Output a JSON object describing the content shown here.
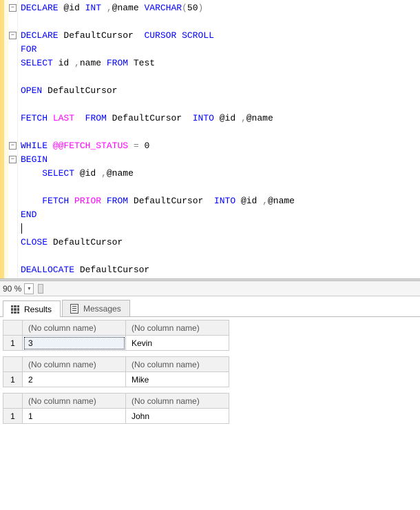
{
  "editor": {
    "lines": [
      {
        "fold": "-",
        "tokens": [
          {
            "t": "DECLARE",
            "c": "kw"
          },
          {
            "t": " @id ",
            "c": "id"
          },
          {
            "t": "INT",
            "c": "ty"
          },
          {
            "t": " ",
            "c": "id"
          },
          {
            "t": ",",
            "c": "op"
          },
          {
            "t": "@name ",
            "c": "id"
          },
          {
            "t": "VARCHAR",
            "c": "ty"
          },
          {
            "t": "(",
            "c": "op"
          },
          {
            "t": "50",
            "c": "num"
          },
          {
            "t": ")",
            "c": "op"
          }
        ]
      },
      {
        "tokens": []
      },
      {
        "fold": "-",
        "tokens": [
          {
            "t": "DECLARE",
            "c": "kw"
          },
          {
            "t": " DefaultCursor  ",
            "c": "id"
          },
          {
            "t": "CURSOR",
            "c": "kw"
          },
          {
            "t": " ",
            "c": "id"
          },
          {
            "t": "SCROLL",
            "c": "kw"
          }
        ]
      },
      {
        "tokens": [
          {
            "t": "FOR",
            "c": "kw"
          }
        ]
      },
      {
        "tokens": [
          {
            "t": "SELECT",
            "c": "kw"
          },
          {
            "t": " id ",
            "c": "id"
          },
          {
            "t": ",",
            "c": "op"
          },
          {
            "t": "name ",
            "c": "id"
          },
          {
            "t": "FROM",
            "c": "kw"
          },
          {
            "t": " Test",
            "c": "id"
          }
        ]
      },
      {
        "tokens": []
      },
      {
        "tokens": [
          {
            "t": "OPEN",
            "c": "kw"
          },
          {
            "t": " DefaultCursor",
            "c": "id"
          }
        ]
      },
      {
        "tokens": []
      },
      {
        "tokens": [
          {
            "t": "FETCH",
            "c": "kw"
          },
          {
            "t": " ",
            "c": "id"
          },
          {
            "t": "LAST",
            "c": "fn"
          },
          {
            "t": "  ",
            "c": "id"
          },
          {
            "t": "FROM",
            "c": "kw"
          },
          {
            "t": " DefaultCursor  ",
            "c": "id"
          },
          {
            "t": "INTO",
            "c": "kw"
          },
          {
            "t": " @id ",
            "c": "id"
          },
          {
            "t": ",",
            "c": "op"
          },
          {
            "t": "@name",
            "c": "id"
          }
        ]
      },
      {
        "tokens": []
      },
      {
        "fold": "-",
        "tokens": [
          {
            "t": "WHILE",
            "c": "kw"
          },
          {
            "t": " ",
            "c": "id"
          },
          {
            "t": "@@FETCH_STATUS",
            "c": "fn"
          },
          {
            "t": " ",
            "c": "id"
          },
          {
            "t": "=",
            "c": "op"
          },
          {
            "t": " 0",
            "c": "num"
          }
        ]
      },
      {
        "fold": "-",
        "tokens": [
          {
            "t": "BEGIN",
            "c": "kw"
          }
        ]
      },
      {
        "tokens": [
          {
            "t": "    ",
            "c": "id"
          },
          {
            "t": "SELECT",
            "c": "kw"
          },
          {
            "t": " @id ",
            "c": "id"
          },
          {
            "t": ",",
            "c": "op"
          },
          {
            "t": "@name",
            "c": "id"
          }
        ]
      },
      {
        "tokens": []
      },
      {
        "tokens": [
          {
            "t": "    ",
            "c": "id"
          },
          {
            "t": "FETCH",
            "c": "kw"
          },
          {
            "t": " ",
            "c": "id"
          },
          {
            "t": "PRIOR",
            "c": "fn"
          },
          {
            "t": " ",
            "c": "id"
          },
          {
            "t": "FROM",
            "c": "kw"
          },
          {
            "t": " DefaultCursor  ",
            "c": "id"
          },
          {
            "t": "INTO",
            "c": "kw"
          },
          {
            "t": " @id ",
            "c": "id"
          },
          {
            "t": ",",
            "c": "op"
          },
          {
            "t": "@name",
            "c": "id"
          }
        ]
      },
      {
        "tokens": [
          {
            "t": "END",
            "c": "kw"
          }
        ]
      },
      {
        "caret": true,
        "tokens": []
      },
      {
        "tokens": [
          {
            "t": "CLOSE",
            "c": "kw"
          },
          {
            "t": " DefaultCursor",
            "c": "id"
          }
        ]
      },
      {
        "tokens": []
      },
      {
        "tokens": [
          {
            "t": "DEALLOCATE",
            "c": "kw"
          },
          {
            "t": " DefaultCursor",
            "c": "id"
          }
        ]
      }
    ]
  },
  "zoom": {
    "value": "90 %"
  },
  "tabs": {
    "results": "Results",
    "messages": "Messages"
  },
  "results": {
    "nocol": "(No column name)",
    "sets": [
      {
        "rownum": "1",
        "c1": "3",
        "c2": "Kevin"
      },
      {
        "rownum": "1",
        "c1": "2",
        "c2": "Mike"
      },
      {
        "rownum": "1",
        "c1": "1",
        "c2": "John"
      }
    ]
  }
}
